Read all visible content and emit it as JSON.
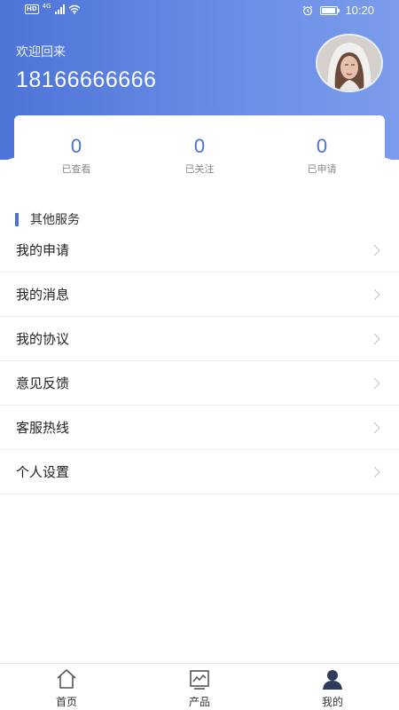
{
  "status_bar": {
    "hd": "HD",
    "network": "4G",
    "time": "10:20",
    "battery_level": 0.9,
    "icons": [
      "hd-icon",
      "signal-icon",
      "wifi-icon",
      "alarm-icon",
      "battery-icon"
    ]
  },
  "profile": {
    "welcome": "欢迎回来",
    "phone": "18166666666"
  },
  "stats": [
    {
      "value": "0",
      "label": "已查看"
    },
    {
      "value": "0",
      "label": "已关注"
    },
    {
      "value": "0",
      "label": "已申请"
    }
  ],
  "services": {
    "title": "其他服务",
    "items": [
      {
        "label": "我的申请"
      },
      {
        "label": "我的消息"
      },
      {
        "label": "我的协议"
      },
      {
        "label": "意见反馈"
      },
      {
        "label": "客服热线"
      },
      {
        "label": "个人设置"
      }
    ]
  },
  "tabbar": {
    "items": [
      {
        "label": "首页",
        "icon": "home-icon"
      },
      {
        "label": "产品",
        "icon": "chart-icon"
      },
      {
        "label": "我的",
        "icon": "user-icon",
        "active": true
      }
    ]
  },
  "colors": {
    "accent": "#4a72d4",
    "header_gradient_start": "#4d74d8",
    "header_gradient_end": "#7b9cea"
  }
}
